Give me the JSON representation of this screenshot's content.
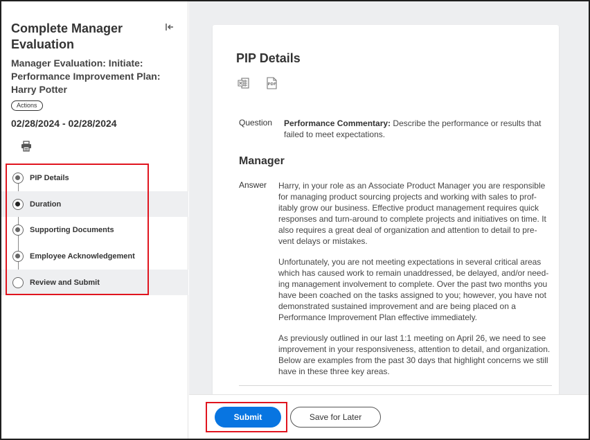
{
  "sidebar": {
    "title": "Complete Manager Evaluation",
    "subtitle": "Manager Evaluation: Initiate: Performance Improvement Plan: Harry Potter",
    "actions_label": "Actions",
    "dates": "02/28/2024 - 02/28/2024",
    "steps": [
      {
        "label": "PIP Details",
        "state": "visited"
      },
      {
        "label": "Duration",
        "state": "current"
      },
      {
        "label": "Supporting Documents",
        "state": "visited"
      },
      {
        "label": "Employee Acknowledgement",
        "state": "visited"
      },
      {
        "label": "Review and Submit",
        "state": "empty"
      }
    ],
    "icons": {
      "collapse": "collapse-left-icon",
      "print": "print-icon"
    }
  },
  "card": {
    "title": "PIP Details",
    "icons": {
      "excel": "excel-export-icon",
      "pdf": "pdf-export-icon"
    },
    "question_label": "Question",
    "question_bold": "Performance Commentary:",
    "question_text": " Describe the performance or results that failed to meet expectations.",
    "manager_heading": "Manager",
    "answer_label": "Answer",
    "answer_paragraphs": [
      "Harry, in your role as an Associate Product Manager you are responsible for managing product sourcing projects and working with sales to prof-itably grow our business. Effective product management requires quick responses and turn-around to complete projects and initiatives on time. It also requires a great deal of organization and attention to detail to pre-vent delays or mistakes.",
      "Unfortunately, you are not meeting expectations in several critical areas which has caused work to remain unaddressed, be delayed, and/or need-ing management involvement to complete. Over the past two months you have been coached on the tasks assigned to you; however, you have not demonstrated sustained improvement and are being placed on a Performance Improvement Plan effective immediately.",
      "As previously outlined in our last 1:1 meeting on April 26, we need to see improvement in your responsiveness, attention to detail, and organization. Below are examples from the past 30 days that highlight concerns we still have in these three key areas."
    ]
  },
  "footer": {
    "submit_label": "Submit",
    "save_label": "Save for Later"
  },
  "colors": {
    "primary": "#0875e1",
    "highlight": "#e0141e",
    "sidebar_alt": "#eeeff1",
    "main_bg": "#edeef0"
  }
}
